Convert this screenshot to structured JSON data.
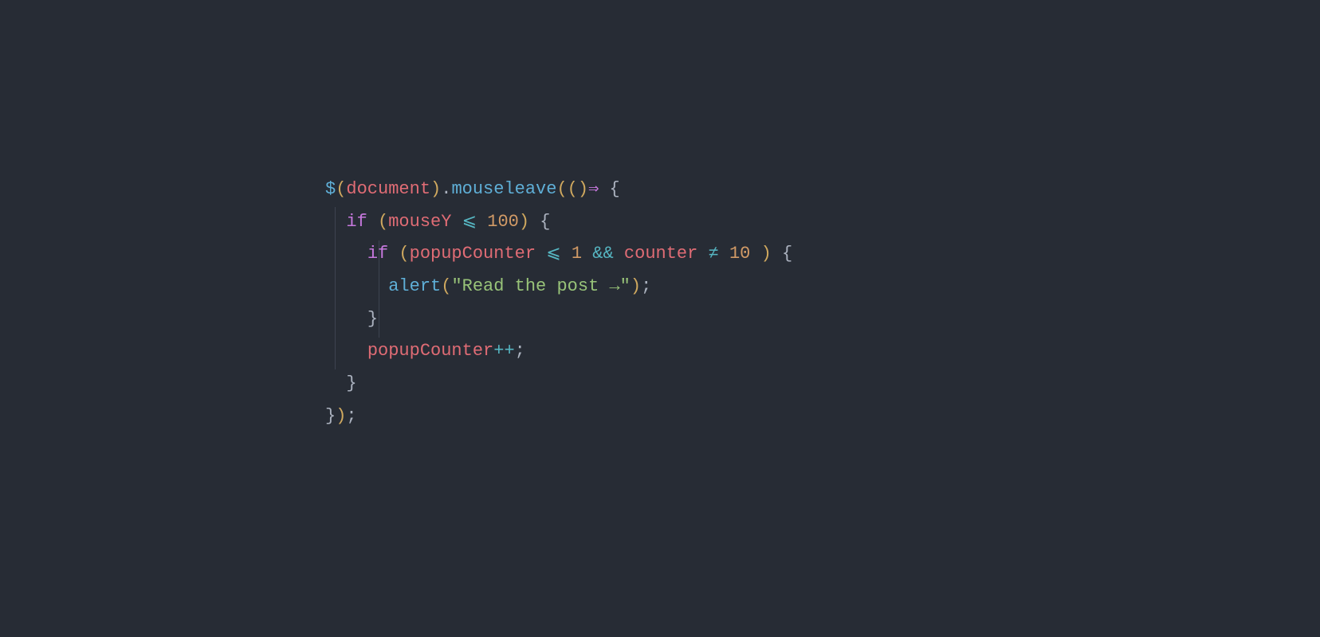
{
  "code": {
    "line1": {
      "dollar": "$",
      "paren_open": "(",
      "document": "document",
      "paren_close": ")",
      "dot": ".",
      "method": "mouseleave",
      "call_open": "(()",
      "arrow": "⇒",
      "brace_open": " {"
    },
    "line2": {
      "indent": "  ",
      "if": "if",
      "space": " ",
      "paren_open": "(",
      "var": "mouseY",
      "op": " ⩽ ",
      "num": "100",
      "paren_close": ")",
      "brace": " {"
    },
    "line3": {
      "indent": "    ",
      "if": "if",
      "space": " ",
      "paren_open": "(",
      "var1": "popupCounter",
      "op1": " ⩽ ",
      "num1": "1",
      "and": " && ",
      "var2": "counter",
      "op2": " ≠ ",
      "num2": "10",
      "space2": " ",
      "paren_close": ")",
      "brace": " {"
    },
    "line4": {
      "indent": "      ",
      "fn": "alert",
      "paren_open": "(",
      "str": "\"Read the post →\"",
      "paren_close": ")",
      "semi": ";"
    },
    "line5": {
      "indent": "    ",
      "brace": "}"
    },
    "line6": {
      "indent": "    ",
      "var": "popupCounter",
      "op": "++",
      "semi": ";"
    },
    "line7": {
      "indent": "  ",
      "brace": "}"
    },
    "line8": {
      "brace": "}",
      "paren": ")",
      "semi": ";"
    }
  }
}
